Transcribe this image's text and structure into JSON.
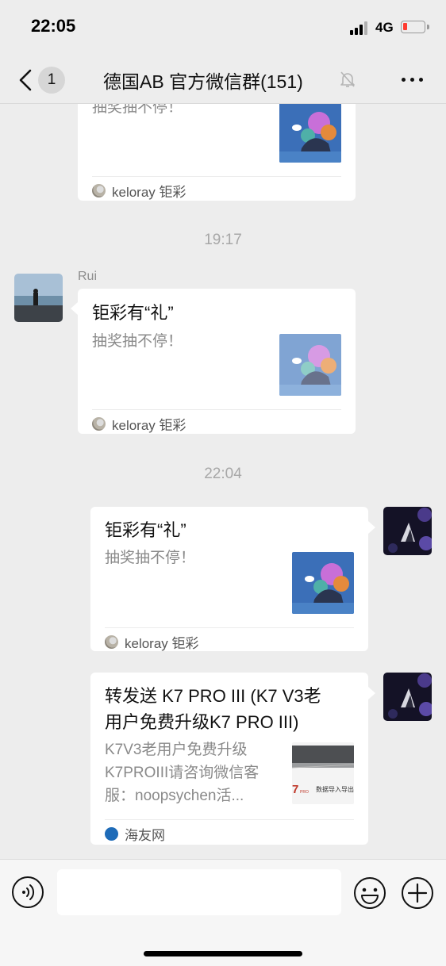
{
  "status": {
    "time": "22:05",
    "network": "4G",
    "battery_level": 0.2,
    "battery_color": "#ff3b30"
  },
  "nav": {
    "unread_count": "1",
    "title": "德国AB  官方微信群(151)"
  },
  "messages": [
    {
      "sender": "",
      "title": "",
      "desc": "抽奖抽不停！",
      "source": "keloray 钜彩"
    },
    {
      "time": "19:17"
    },
    {
      "sender": "Rui",
      "title": "钜彩有“礼”",
      "desc": "抽奖抽不停！",
      "source": "keloray 钜彩"
    },
    {
      "time": "22:04"
    },
    {
      "sender": "",
      "title": "钜彩有“礼”",
      "desc": "抽奖抽不停！",
      "source": "keloray 钜彩"
    },
    {
      "sender": "",
      "title_lines": [
        "转发送 K7 PRO III (K7 V3老",
        "用户免费升级K7 PRO III)"
      ],
      "desc_lines": [
        "K7V3老用户免费升级",
        "K7PROIII请咨询微信客",
        "服：noopsychen活..."
      ],
      "thumb_caption": "数据导入导出",
      "source": "海友网"
    }
  ],
  "input": {
    "placeholder": ""
  },
  "colors": {
    "background": "#ededed",
    "card": "#ffffff",
    "muted_text": "#8a8a8a",
    "time_text": "#a7a7a7"
  }
}
